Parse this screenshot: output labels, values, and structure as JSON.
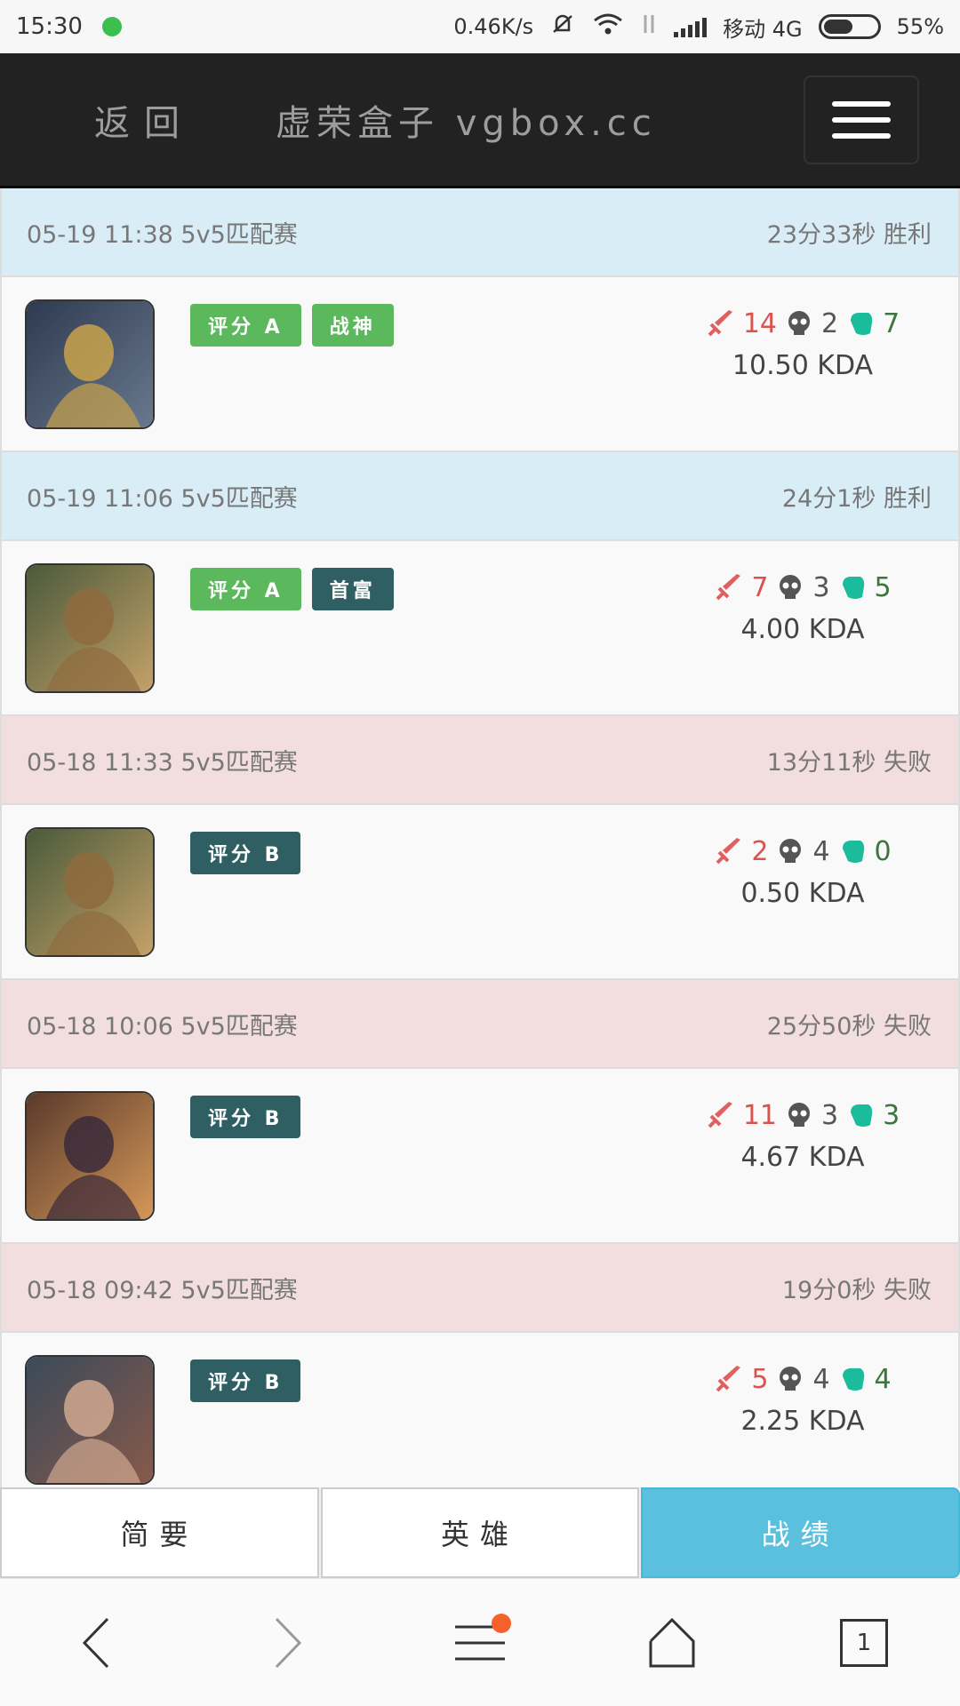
{
  "status_bar": {
    "time": "15:30",
    "net_speed": "0.46K/s",
    "carrier": "移动 4G",
    "battery": "55%"
  },
  "navbar": {
    "back_label": "返回",
    "brand": "虚荣盒子 vgbox.cc"
  },
  "matches": [
    {
      "head_left": "05-19 11:38 5v5匹配赛",
      "head_right": "23分33秒 胜利",
      "result": "win",
      "hero_icon": "hero-portrait-armored-warrior",
      "badges": [
        {
          "label": "评分 A",
          "style": "green"
        },
        {
          "label": "战神",
          "style": "green"
        }
      ],
      "kills": "14",
      "deaths": "2",
      "assists": "7",
      "kda": "10.50 KDA"
    },
    {
      "head_left": "05-19 11:06 5v5匹配赛",
      "head_right": "24分1秒 胜利",
      "result": "win",
      "hero_icon": "hero-portrait-brawler",
      "badges": [
        {
          "label": "评分 A",
          "style": "green"
        },
        {
          "label": "首富",
          "style": "dark"
        }
      ],
      "kills": "7",
      "deaths": "3",
      "assists": "5",
      "kda": "4.00 KDA"
    },
    {
      "head_left": "05-18 11:33 5v5匹配赛",
      "head_right": "13分11秒 失败",
      "result": "loss",
      "hero_icon": "hero-portrait-brawler",
      "badges": [
        {
          "label": "评分 B",
          "style": "dark"
        }
      ],
      "kills": "2",
      "deaths": "4",
      "assists": "0",
      "kda": "0.50 KDA"
    },
    {
      "head_left": "05-18 10:06 5v5匹配赛",
      "head_right": "25分50秒 失败",
      "result": "loss",
      "hero_icon": "hero-portrait-horned-warrior",
      "badges": [
        {
          "label": "评分 B",
          "style": "dark"
        }
      ],
      "kills": "11",
      "deaths": "3",
      "assists": "3",
      "kda": "4.67 KDA"
    },
    {
      "head_left": "05-18 09:42 5v5匹配赛",
      "head_right": "19分0秒 失败",
      "result": "loss",
      "hero_icon": "hero-portrait-gunslinger",
      "badges": [
        {
          "label": "评分 B",
          "style": "dark"
        }
      ],
      "kills": "5",
      "deaths": "4",
      "assists": "4",
      "kda": "2.25 KDA"
    }
  ],
  "tabs": [
    {
      "label": "简要",
      "active": false
    },
    {
      "label": "英雄",
      "active": false
    },
    {
      "label": "战绩",
      "active": true
    }
  ],
  "browser_bar": {
    "tab_count": "1"
  },
  "colors": {
    "win_bg": "#d9edf7",
    "loss_bg": "#f2dede",
    "badge_green": "#5cb85c",
    "badge_dark": "#2f5f62",
    "active_tab": "#5bc0de",
    "kills": "#d9534f",
    "assists_icon": "#1abc9c"
  }
}
